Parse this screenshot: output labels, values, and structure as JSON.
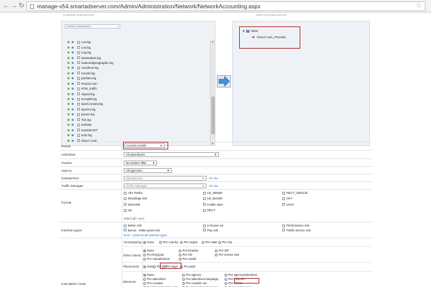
{
  "browser": {
    "url": "manage-v54.smartadserver.com/Admin/Administration/Network/NetworkAccounting.aspx"
  },
  "placements": {
    "available_title": "Available placements",
    "selected_title": "Selected placements",
    "search_placeholder": "Search a placement...",
    "available_items": [
      "Lev.bg",
      "Lev.bg",
      "Log.bg",
      "Moetodete.bg",
      "Nationalgeographic.bg",
      "novaleve.bg",
      "novatv.bg",
      "parliam.bg",
      "Rozali.com",
      "RTB_traffic",
      "Signal.bg",
      "smoptik.bg",
      "sport.novatv.bg",
      "sportni.bg",
      "pravni.bg",
      "Ton.bg",
      "testsite",
      "testSMART",
      "tv24.bg",
      "vboo7.com",
      "Vboo7.com_Prenofa"
    ],
    "selected_root": "Sites",
    "selected_child": "Vboo7.com_Prenofa"
  },
  "form": {
    "period": {
      "label": "Period",
      "value": "Current month"
    },
    "advertiser": {
      "label": "Advertiser",
      "value": "All advertisers"
    },
    "tracker": {
      "label": "Tracker",
      "value": "No tracker filter"
    },
    "agency": {
      "label": "Agency",
      "value": "All agencies"
    },
    "salesperson": {
      "label": "Salesperson",
      "value": "Salesperson",
      "link": "It's me"
    },
    "traffic_manager": {
      "label": "Traffic Manager",
      "value": "Traffic Manager",
      "link": "It's me"
    },
    "format": {
      "label": "Format",
      "col1": [
        "Abv Pasha",
        "Brandings 3x0",
        "DSHAPE",
        "LB"
      ],
      "col2": [
        "LB_468x60",
        "LB_554x80",
        "mobile sites",
        "RECT"
      ],
      "col3": [
        "RECT_300x125",
        "SKY",
        "VAST"
      ],
      "select_prefix": "Select all",
      "select_sep": " / ",
      "select_none": "none"
    },
    "insertion_types": {
      "label": "Insertion types",
      "col1": [
        "Better Ads",
        "Bonus - Make-good Ads"
      ],
      "col2": [
        "In-house Ad",
        "Pay Ads"
      ],
      "col3": [
        "Performance Ads",
        "Public service Ads"
      ],
      "check_all": "heck",
      "uncheck_all": "Uncheck all insertion types"
    },
    "calculation_mode": {
      "label": "Calculation mode",
      "geotargeting": {
        "label": "Geotargeting",
        "options": [
          "None",
          "Per country",
          "Per region",
          "Per state",
          "Per city"
        ]
      },
      "other_criteria": {
        "label": "Other criteria",
        "row1": [
          "None",
          "Per browser",
          "Per ISP"
        ],
        "row2": [
          "Per lineypod",
          "Per OS",
          "Per screen size"
        ],
        "row3": [
          "Per manufacturer",
          "Per model"
        ]
      },
      "placements": {
        "label": "Placements",
        "options": [
          "None",
          "Per site",
          "Per page",
          "Per pack"
        ]
      },
      "elements": {
        "label": "Elements",
        "col1": [
          "None",
          "Per advertiser",
          "Per creative",
          "Per format/creative size"
        ],
        "col2": [
          "Per agency",
          "Per advertiser/campaign",
          "Per creative set",
          "Per format/insertion type"
        ],
        "col3": [
          "Per agency/advertiser",
          "Per insertion",
          "Per format",
          "Per insertion type"
        ]
      }
    }
  },
  "colors": {
    "highlight": "#b52a2a",
    "link": "#2d6fbf",
    "panel_bg": "#eef2f6"
  }
}
